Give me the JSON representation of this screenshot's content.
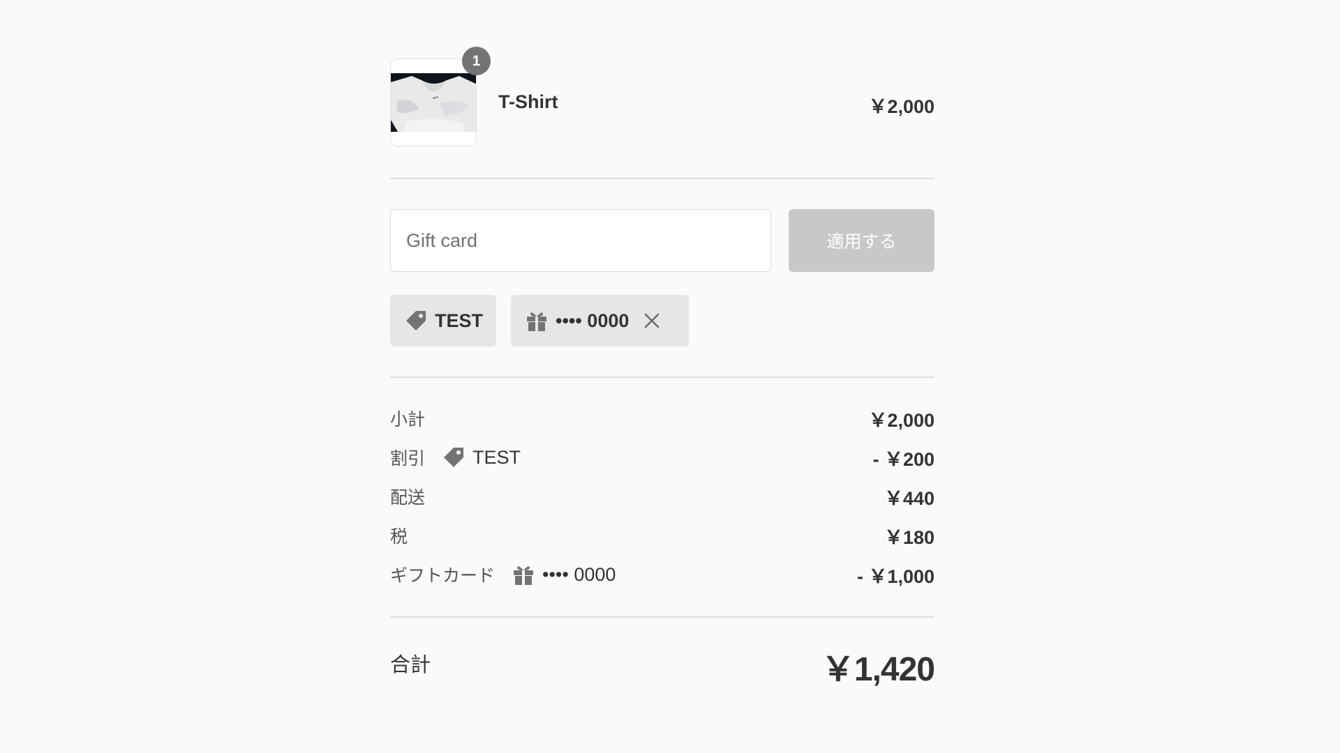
{
  "cart": {
    "item": {
      "name": "T-Shirt",
      "price": "￥2,000",
      "quantity": "1",
      "image": "t-shirt-photo"
    }
  },
  "gift_card_form": {
    "placeholder": "Gift card",
    "apply_label": "適用する"
  },
  "applied": {
    "discount_code": "TEST",
    "gift_card_masked": "•••• 0000"
  },
  "lines": {
    "subtotal": {
      "label": "小計",
      "amount": "￥2,000"
    },
    "discount": {
      "label": "割引",
      "code": "TEST",
      "amount": "- ￥200"
    },
    "shipping": {
      "label": "配送",
      "amount": "￥440"
    },
    "tax": {
      "label": "税",
      "amount": "￥180"
    },
    "gift_card": {
      "label": "ギフトカード",
      "masked": "•••• 0000",
      "amount": "- ￥1,000"
    }
  },
  "total": {
    "label": "合計",
    "amount": "￥1,420"
  },
  "icons": {
    "discount": "tag-icon",
    "gift": "gift-icon",
    "remove": "close-icon"
  },
  "colors": {
    "background": "#fafafa",
    "badge": "#737373",
    "apply_button_disabled": "#c8c8c8",
    "chip_background": "#e6e6e6",
    "icon": "#737373"
  }
}
